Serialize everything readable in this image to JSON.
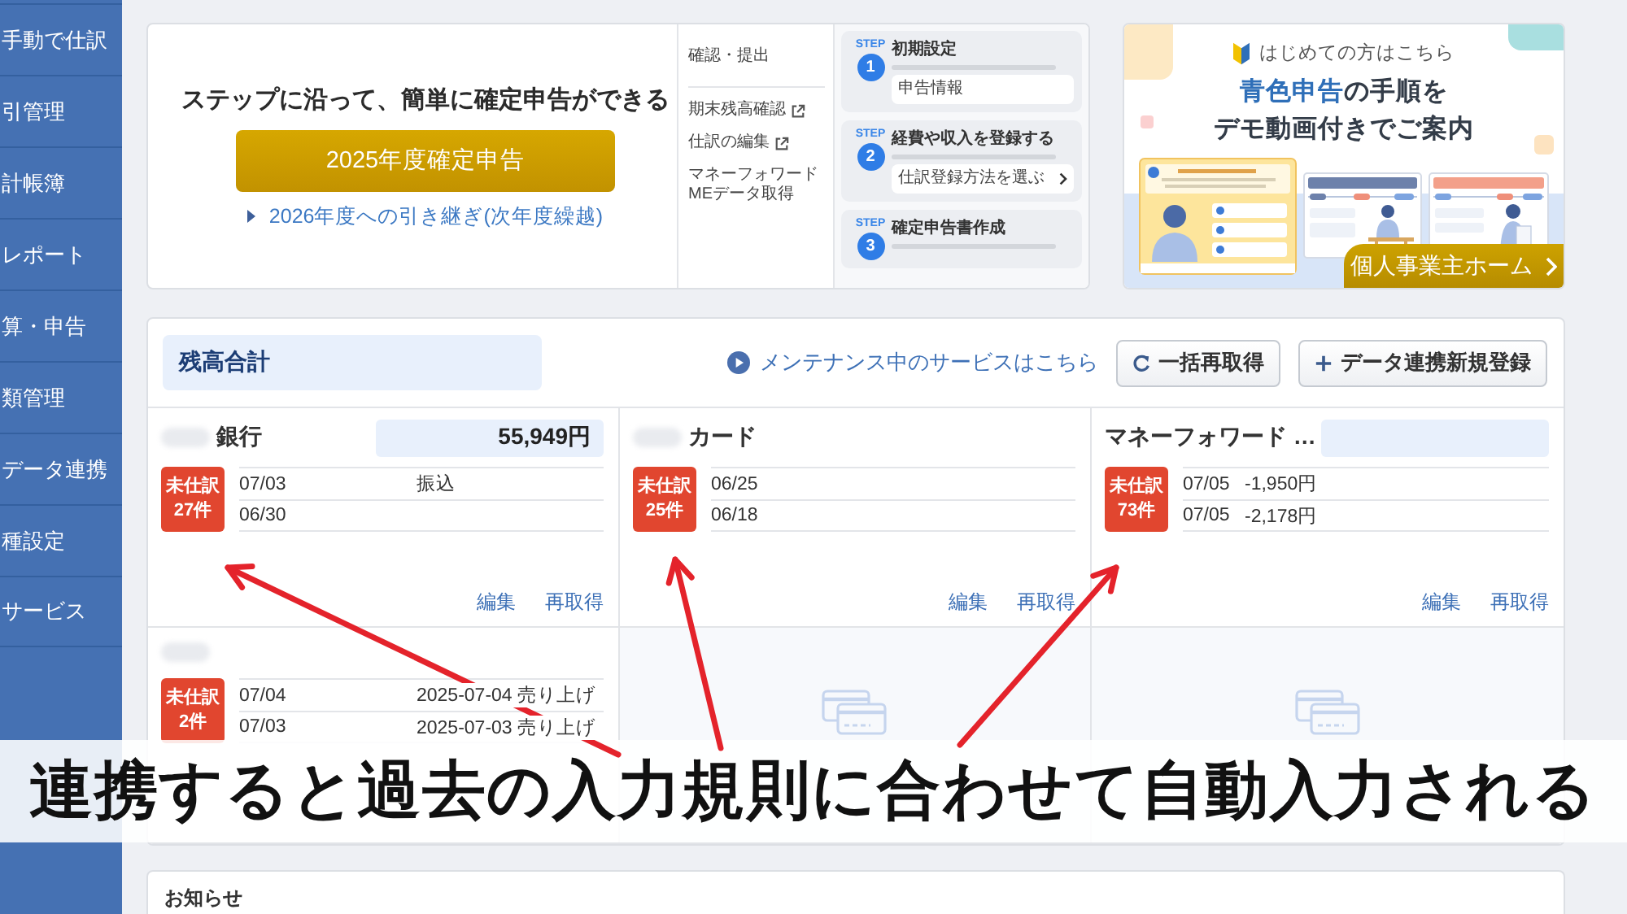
{
  "sidebar": {
    "items": [
      {
        "label": "手動で仕訳"
      },
      {
        "label": "引管理"
      },
      {
        "label": "計帳簿"
      },
      {
        "label": "レポート"
      },
      {
        "label": "算・申告"
      },
      {
        "label": "類管理"
      },
      {
        "label": "データ連携"
      },
      {
        "label": "種設定"
      },
      {
        "label": "サービス"
      }
    ]
  },
  "tax_card": {
    "title": "ステップに沿って、簡単に確定申告ができる",
    "button": "2025年度確定申告",
    "link": "2026年度への引き継ぎ(次年度繰越)",
    "preview": {
      "nav_groups": [
        {
          "items": [
            {
              "label": "確認・提出",
              "external": false
            }
          ]
        },
        {
          "items": [
            {
              "label": "期末残高確認",
              "external": true
            },
            {
              "label": "仕訳の編集",
              "external": true
            },
            {
              "label": "マネーフォワード MEデータ取得",
              "external": false
            }
          ]
        }
      ],
      "steps": [
        {
          "tag": "STEP",
          "number": "1",
          "title": "初期設定",
          "action": "申告情報",
          "chevron": false
        },
        {
          "tag": "STEP",
          "number": "2",
          "title": "経費や収入を登録する",
          "action": "仕訳登録方法を選ぶ",
          "chevron": true
        },
        {
          "tag": "STEP",
          "number": "3",
          "title": "確定申告書作成"
        }
      ]
    }
  },
  "banner": {
    "eyebrow": "はじめての方はこちら",
    "headline": [
      [
        {
          "text": "青色申告",
          "accent": true
        },
        {
          "text": "の手順を",
          "accent": false
        }
      ],
      [
        {
          "text": "デモ動画付きでご案内",
          "accent": false
        }
      ]
    ],
    "button": "個人事業主ホーム"
  },
  "balances": {
    "total_label": "残高合計",
    "maintenance_link": "メンテナンス中のサービスはこちら",
    "buttons": [
      {
        "label": "一括再取得",
        "kind": "refresh"
      },
      {
        "label": "データ連携新規登録",
        "kind": "add"
      }
    ],
    "accounts": [
      {
        "kind": "account",
        "name_redacted": true,
        "name": "銀行",
        "balance_box": true,
        "balance": "55,949円",
        "badge": [
          "未仕訳",
          "27件"
        ],
        "transactions": [
          {
            "date": "07/03",
            "memo": "振込"
          },
          {
            "date": "06/30"
          }
        ],
        "actions": [
          "編集",
          "再取得"
        ]
      },
      {
        "kind": "account",
        "name_redacted": true,
        "name": "カード",
        "balance_box": false,
        "badge": [
          "未仕訳",
          "25件"
        ],
        "transactions": [
          {
            "date": "06/25"
          },
          {
            "date": "06/18"
          }
        ],
        "actions": [
          "編集",
          "再取得"
        ]
      },
      {
        "kind": "account",
        "name_redacted": false,
        "name": "マネーフォワード …",
        "balance_box": true,
        "badge": [
          "未仕訳",
          "73件"
        ],
        "transactions": [
          {
            "date": "07/05",
            "amount": "-1,950円"
          },
          {
            "date": "07/05",
            "amount": "-2,178円"
          }
        ],
        "actions": [
          "編集",
          "再取得"
        ]
      },
      {
        "kind": "account",
        "name_redacted": true,
        "balance_box": false,
        "badge": [
          "未仕訳",
          "2件"
        ],
        "transactions": [
          {
            "date": "07/04",
            "memo": "2025-07-04 売り上げ"
          },
          {
            "date": "07/03",
            "memo": "2025-07-03 売り上げ"
          }
        ]
      },
      {
        "kind": "empty"
      },
      {
        "kind": "empty"
      }
    ]
  },
  "caption": "連携すると過去の入力規則に合わせて自動入力される",
  "notice": {
    "title": "お知らせ"
  }
}
